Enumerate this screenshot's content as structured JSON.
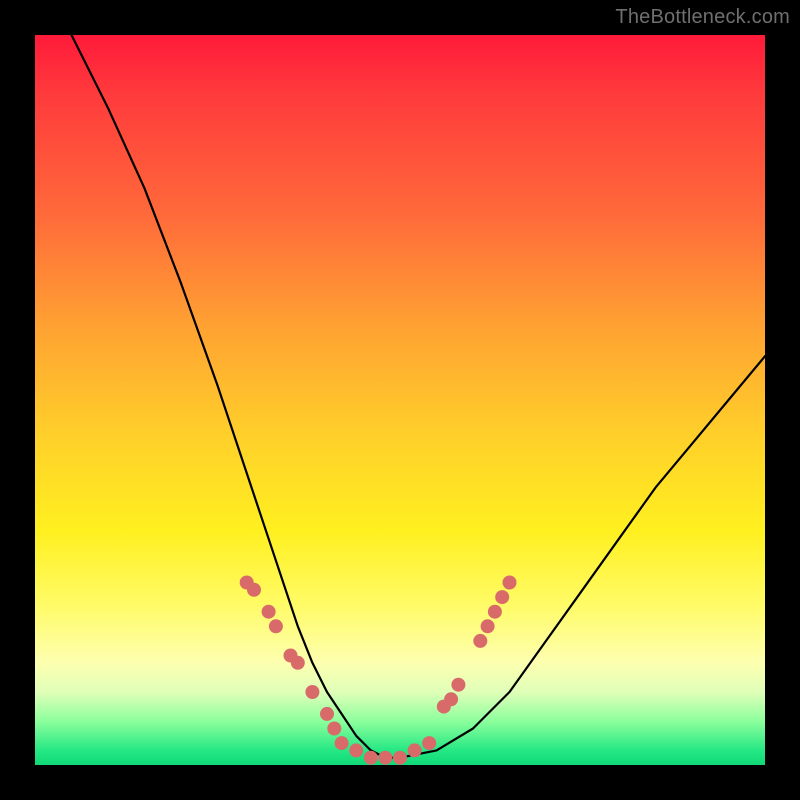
{
  "watermark": "TheBottleneck.com",
  "colors": {
    "dot": "#d86a6a",
    "curve": "#000000",
    "frame": "#000000"
  },
  "chart_data": {
    "type": "line",
    "title": "",
    "xlabel": "",
    "ylabel": "",
    "xlim": [
      0,
      100
    ],
    "ylim": [
      0,
      100
    ],
    "grid": false,
    "legend": false,
    "note": "No axis ticks, labels, or units are visible in the image; values below are estimated from pixel positions as a percentage of each axis range.",
    "series": [
      {
        "name": "curve",
        "type": "line",
        "x": [
          5,
          10,
          15,
          20,
          25,
          28,
          30,
          32,
          34,
          36,
          38,
          40,
          42,
          44,
          46,
          48,
          50,
          55,
          60,
          65,
          70,
          75,
          80,
          85,
          90,
          95,
          100
        ],
        "y": [
          100,
          90,
          79,
          66,
          52,
          43,
          37,
          31,
          25,
          19,
          14,
          10,
          7,
          4,
          2,
          1,
          1,
          2,
          5,
          10,
          17,
          24,
          31,
          38,
          44,
          50,
          56
        ]
      },
      {
        "name": "markers-left-branch",
        "type": "scatter",
        "x": [
          29,
          30,
          32,
          33,
          35,
          36,
          38,
          40,
          41
        ],
        "y": [
          25,
          24,
          21,
          19,
          15,
          14,
          10,
          7,
          5
        ]
      },
      {
        "name": "markers-valley",
        "type": "scatter",
        "x": [
          42,
          44,
          46,
          48,
          50,
          52,
          54
        ],
        "y": [
          3,
          2,
          1,
          1,
          1,
          2,
          3
        ]
      },
      {
        "name": "markers-right-branch",
        "type": "scatter",
        "x": [
          56,
          57,
          58,
          61,
          62,
          63,
          64,
          65
        ],
        "y": [
          8,
          9,
          11,
          17,
          19,
          21,
          23,
          25
        ]
      }
    ]
  }
}
